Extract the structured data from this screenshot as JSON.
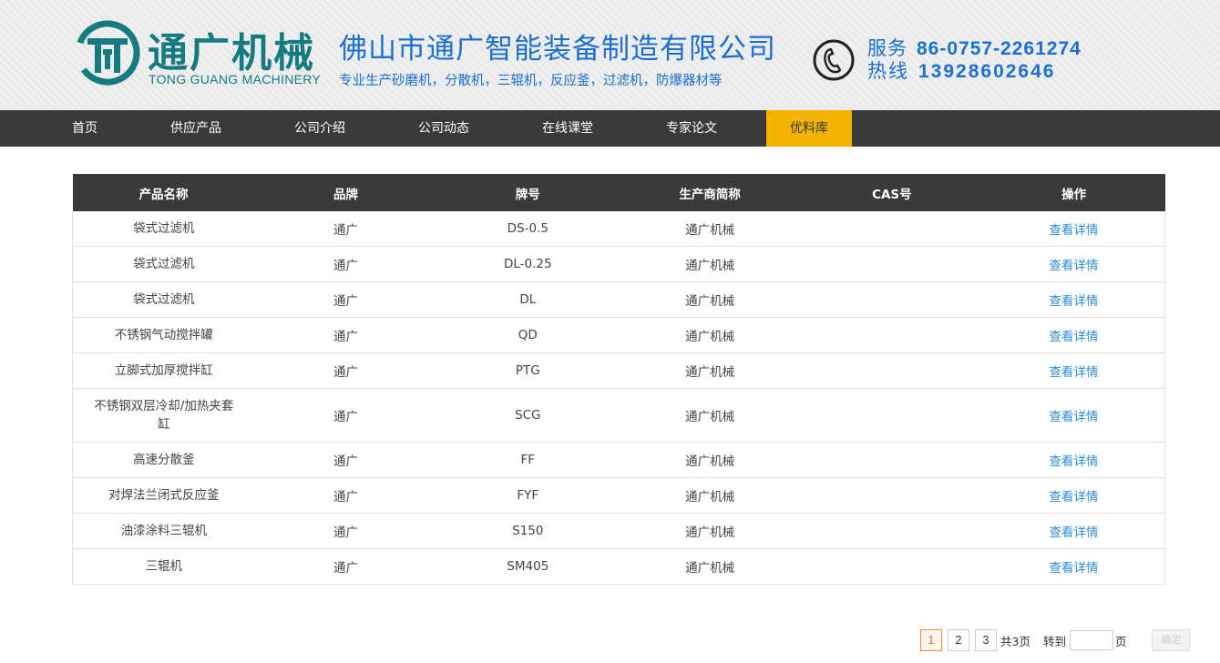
{
  "header": {
    "brand_cn": "通广机械",
    "brand_en": "TONG GUANG MACHINERY",
    "company_name": "佛山市通广智能装备制造有限公司",
    "slogan": "专业生产砂磨机，分散机，三辊机，反应釜，过滤机，防爆器材等",
    "hotline_label1": "服务",
    "hotline_num1": "86-0757-2261274",
    "hotline_label2": "热线",
    "hotline_num2": "13928602646",
    "logo_icon": "tg-logo-icon",
    "phone_icon": "phone-icon",
    "colors": {
      "brand_teal": "#157b80",
      "brand_blue": "#1a6fd0"
    }
  },
  "nav": {
    "items": [
      "首页",
      "供应产品",
      "公司介绍",
      "公司动态",
      "在线课堂",
      "专家论文",
      "优料库"
    ],
    "active_index": 6,
    "colors": {
      "bar": "#3a3a3a",
      "active": "#f3b300"
    }
  },
  "table": {
    "headers": [
      "产品名称",
      "品牌",
      "牌号",
      "生产商简称",
      "CAS号",
      "操作"
    ],
    "rows": [
      [
        "袋式过滤机",
        "通广",
        "DS-0.5",
        "通广机械",
        "",
        "查看详情"
      ],
      [
        "袋式过滤机",
        "通广",
        "DL-0.25",
        "通广机械",
        "",
        "查看详情"
      ],
      [
        "袋式过滤机",
        "通广",
        "DL",
        "通广机械",
        "",
        "查看详情"
      ],
      [
        "不锈钢气动搅拌罐",
        "通广",
        "QD",
        "通广机械",
        "",
        "查看详情"
      ],
      [
        "立脚式加厚搅拌缸",
        "通广",
        "PTG",
        "通广机械",
        "",
        "查看详情"
      ],
      [
        "不锈钢双层冷却/加热夹套缸",
        "通广",
        "SCG",
        "通广机械",
        "",
        "查看详情"
      ],
      [
        "高速分散釜",
        "通广",
        "FF",
        "通广机械",
        "",
        "查看详情"
      ],
      [
        "对焊法兰闭式反应釜",
        "通广",
        "FYF",
        "通广机械",
        "",
        "查看详情"
      ],
      [
        "油漆涂料三辊机",
        "通广",
        "S150",
        "通广机械",
        "",
        "查看详情"
      ],
      [
        "三辊机",
        "通广",
        "SM405",
        "通广机械",
        "",
        "查看详情"
      ]
    ],
    "link_color": "#2f8fd6"
  },
  "pager": {
    "pages": [
      "1",
      "2",
      "3"
    ],
    "current": "1",
    "total": "共3页",
    "goto": "转到",
    "page_unit": "页",
    "jump_value": "",
    "confirm": "确定"
  }
}
